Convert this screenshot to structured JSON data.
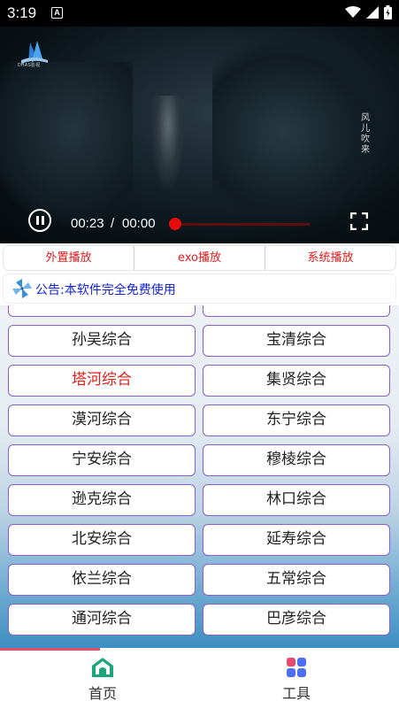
{
  "status_bar": {
    "time": "3:19",
    "notification_letter": "A",
    "icons": [
      "wifi-icon",
      "signal-icon",
      "battery-icon"
    ]
  },
  "video": {
    "logo_text": "DHAS影视",
    "watermark": "风儿吹来",
    "current_time": "00:23",
    "separator": "/",
    "total_time": "00:00",
    "progress": 0.0,
    "state": "playing"
  },
  "player_tabs": [
    {
      "label": "外置播放"
    },
    {
      "label": "exo播放"
    },
    {
      "label": "系统播放"
    }
  ],
  "notice": {
    "icon": "pinwheel-icon",
    "text": "公告:本软件完全免费使用"
  },
  "channels": [
    {
      "label": ""
    },
    {
      "label": ""
    },
    {
      "label": "孙吴综合"
    },
    {
      "label": "宝清综合"
    },
    {
      "label": "塔河综合"
    },
    {
      "label": "集贤综合"
    },
    {
      "label": "漠河综合"
    },
    {
      "label": "东宁综合"
    },
    {
      "label": "宁安综合"
    },
    {
      "label": "穆棱综合"
    },
    {
      "label": "逊克综合"
    },
    {
      "label": "林口综合"
    },
    {
      "label": "北安综合"
    },
    {
      "label": "延寿综合"
    },
    {
      "label": "依兰综合"
    },
    {
      "label": "五常综合"
    },
    {
      "label": "通河综合"
    },
    {
      "label": "巴彦综合"
    }
  ],
  "active_channel": "塔河综合",
  "bottom_nav": [
    {
      "label": "首页",
      "icon": "home-icon",
      "selected": true
    },
    {
      "label": "工具",
      "icon": "grid-tools-icon",
      "selected": false
    }
  ],
  "colors": {
    "accent_red": "#e31c1c",
    "notice_blue": "#1424d8",
    "cell_border": "#8a5fc7",
    "tab_accent": "#e8496f"
  }
}
